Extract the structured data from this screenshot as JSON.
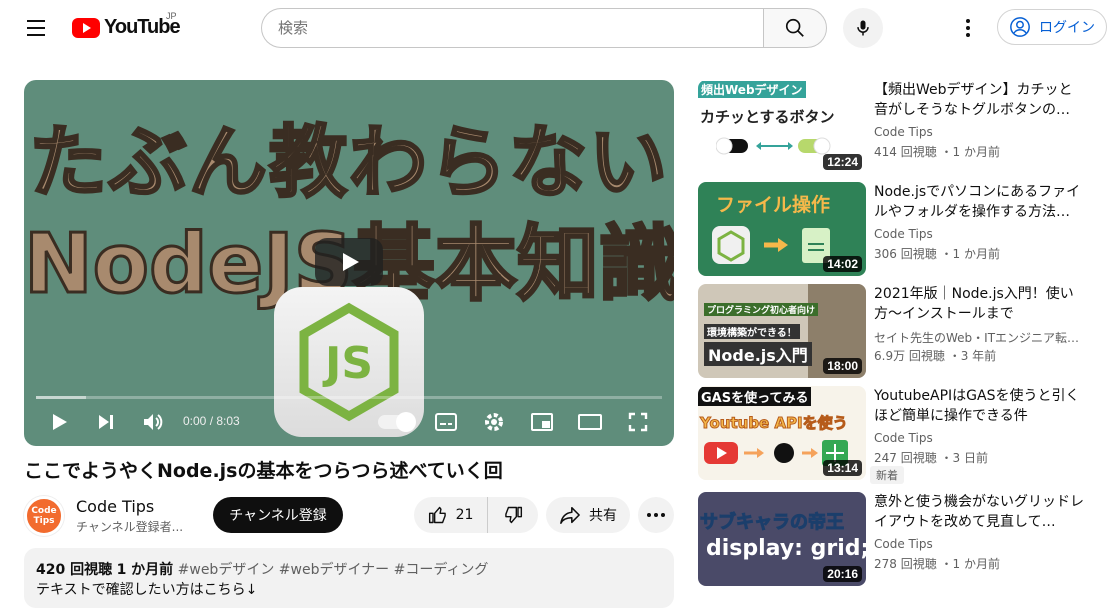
{
  "header": {
    "logo_text": "YouTube",
    "country": "JP",
    "search_placeholder": "検索",
    "login_label": "ログイン"
  },
  "player": {
    "thumb_line1": "たぶん教わらない",
    "thumb_line2": "NodeJS基本知識",
    "time_display": "0:00 / 8:03",
    "progress_fraction": 0
  },
  "video": {
    "title": "ここでようやくNode.jsの基本をつらつら述べていく回",
    "channel_name": "Code Tips",
    "channel_avatar_text": "Code Tips",
    "channel_subs": "チャンネル登録者...",
    "subscribe_label": "チャンネル登録",
    "like_count": "21",
    "share_label": "共有",
    "views": "420 回視聴",
    "age": "1 か月前",
    "tags": "#webデザイン #webデザイナー #コーディング",
    "desc_line": "テキストで確認したい方はこちら↓"
  },
  "recommendations": [
    {
      "thumb_label_top": "頻出Webデザイン",
      "thumb_label_main": "カチッとするボタン",
      "duration": "12:24",
      "title": "【頻出Webデザイン】カチッと音がしそうなトグルボタンの…",
      "channel": "Code Tips",
      "stats": "414 回視聴 ・1 か月前",
      "badge": ""
    },
    {
      "thumb_label_top": "ファイル操作",
      "thumb_label_main": "",
      "duration": "14:02",
      "title": "Node.jsでパソコンにあるファイルやフォルダを操作する方法…",
      "channel": "Code Tips",
      "stats": "306 回視聴 ・1 か月前",
      "badge": ""
    },
    {
      "thumb_label_top": "プログラミング初心者向け",
      "thumb_label_main": "Node.js入門",
      "thumb_label_sub": "環境構築ができる！",
      "duration": "18:00",
      "title": "2021年版｜Node.js入門！使い方〜インストールまで",
      "channel": "セイト先生のWeb・ITエンジニア転…",
      "stats": "6.9万 回視聴 ・3 年前",
      "badge": ""
    },
    {
      "thumb_label_top": "GASを使ってみる",
      "thumb_label_main": "Youtube APIを使う",
      "duration": "13:14",
      "title": "YoutubeAPIはGASを使うと引くほど簡単に操作できる件",
      "channel": "Code Tips",
      "stats": "247 回視聴 ・3 日前",
      "badge": "新着"
    },
    {
      "thumb_label_top": "サブキャラの帝王",
      "thumb_label_main": "display: grid;",
      "duration": "20:16",
      "title": "意外と使う機会がないグリッドレイアウトを改めて見直して…",
      "channel": "Code Tips",
      "stats": "278 回視聴 ・1 か月前",
      "badge": ""
    }
  ],
  "colors": {
    "brand_red": "#ff0000",
    "link_blue": "#065fd4",
    "player_bg": "#5f8d7b"
  }
}
